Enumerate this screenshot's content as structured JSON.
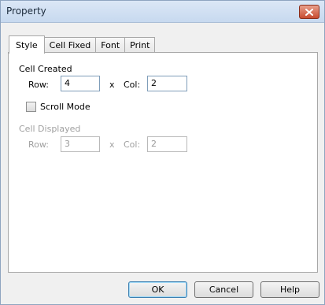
{
  "window": {
    "title": "Property"
  },
  "tabs": [
    {
      "label": "Style",
      "active": true
    },
    {
      "label": "Cell Fixed",
      "active": false
    },
    {
      "label": "Font",
      "active": false
    },
    {
      "label": "Print",
      "active": false
    }
  ],
  "style": {
    "cell_created": {
      "title": "Cell Created",
      "row_label": "Row:",
      "row_value": "4",
      "x_label": "x",
      "col_label": "Col:",
      "col_value": "2"
    },
    "scroll_mode": {
      "label": "Scroll Mode",
      "checked": false
    },
    "cell_displayed": {
      "title": "Cell Displayed",
      "row_label": "Row:",
      "row_value": "3",
      "x_label": "x",
      "col_label": "Col:",
      "col_value": "2",
      "enabled": false
    }
  },
  "buttons": {
    "ok": "OK",
    "cancel": "Cancel",
    "help": "Help"
  },
  "icons": {
    "close": "close-icon"
  },
  "colors": {
    "close_button": "#c84c31",
    "default_button_border": "#3c7fb1"
  }
}
